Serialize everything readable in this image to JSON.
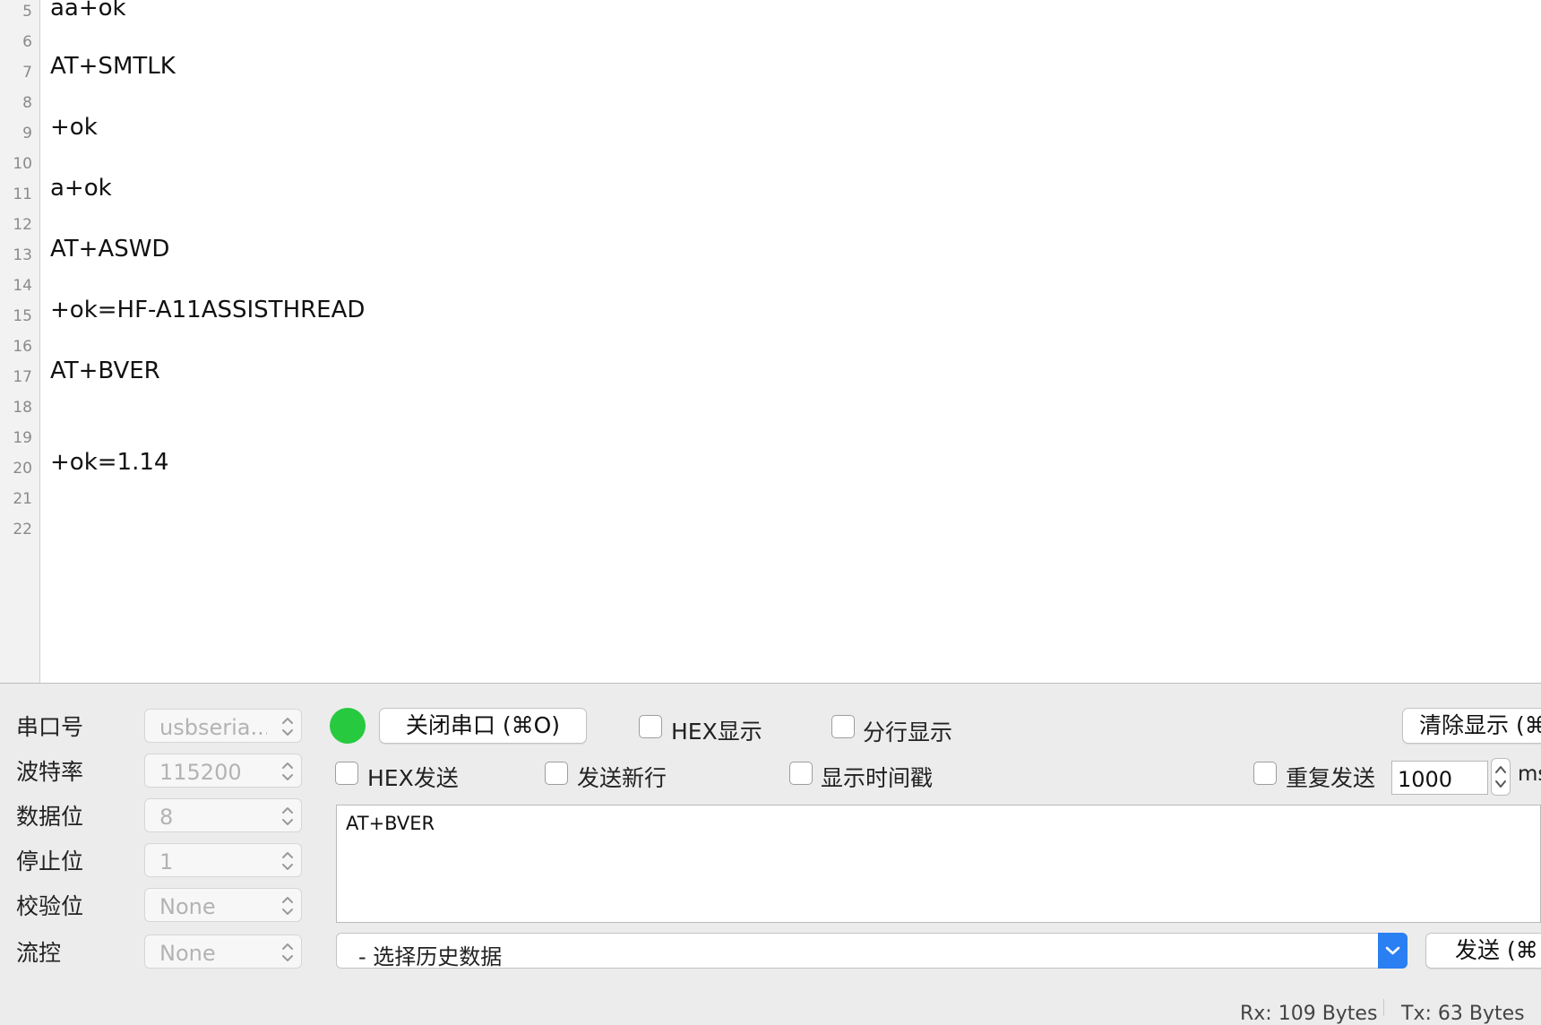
{
  "editor": {
    "lines": [
      {
        "no": "5",
        "text": "aa+ok"
      },
      {
        "no": "6",
        "text": ""
      },
      {
        "no": "7",
        "text": "AT+SMTLK"
      },
      {
        "no": "8",
        "text": ""
      },
      {
        "no": "9",
        "text": "+ok"
      },
      {
        "no": "10",
        "text": ""
      },
      {
        "no": "11",
        "text": "a+ok"
      },
      {
        "no": "12",
        "text": ""
      },
      {
        "no": "13",
        "text": "AT+ASWD"
      },
      {
        "no": "14",
        "text": ""
      },
      {
        "no": "15",
        "text": "+ok=HF-A11ASSISTHREAD"
      },
      {
        "no": "16",
        "text": ""
      },
      {
        "no": "17",
        "text": "AT+BVER"
      },
      {
        "no": "18",
        "text": ""
      },
      {
        "no": "19",
        "text": ""
      },
      {
        "no": "20",
        "text": "+ok=1.14"
      },
      {
        "no": "21",
        "text": ""
      },
      {
        "no": "22",
        "text": ""
      }
    ]
  },
  "settings": [
    {
      "label": "串口号",
      "value": "usbseria..."
    },
    {
      "label": "波特率",
      "value": "115200"
    },
    {
      "label": "数据位",
      "value": "8"
    },
    {
      "label": "停止位",
      "value": "1"
    },
    {
      "label": "校验位",
      "value": "None"
    },
    {
      "label": "流控",
      "value": "None"
    }
  ],
  "port_status_color": "#27c93f",
  "controls": {
    "close_port_button": "关闭串口 (⌘O)",
    "hex_display": "HEX显示",
    "split_display": "分行显示",
    "clear_display_button": "清除显示 (⌘",
    "hex_send": "HEX发送",
    "send_newline": "发送新行",
    "show_timestamp": "显示时间戳",
    "repeat_send": "重复发送",
    "repeat_interval": "1000",
    "interval_unit": "ms",
    "send_text": "AT+BVER",
    "history_placeholder": "- 选择历史数据",
    "send_button": "发送 (⌘"
  },
  "status": {
    "rx": "Rx: 109 Bytes",
    "tx": "Tx: 63 Bytes"
  }
}
